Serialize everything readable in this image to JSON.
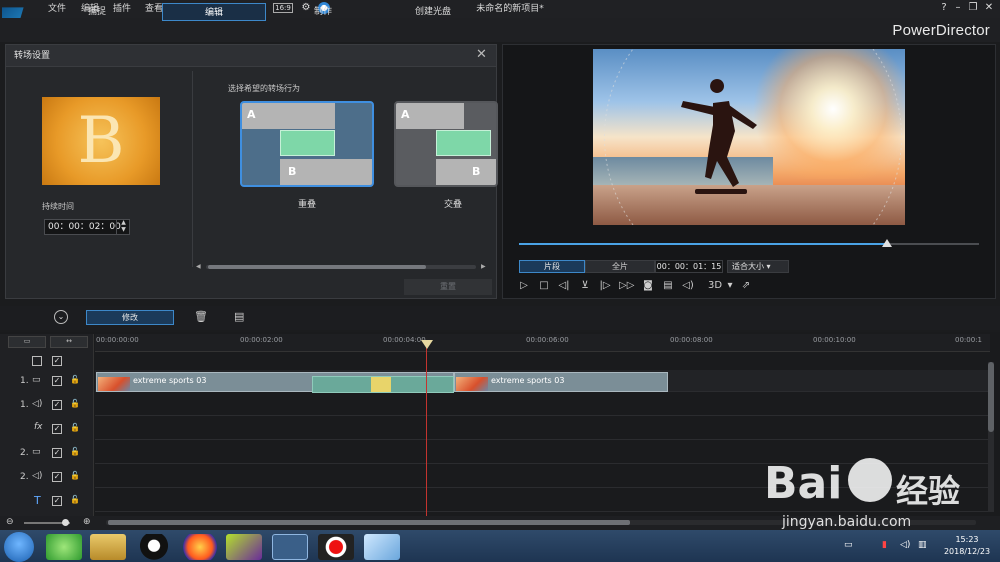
{
  "menu": [
    "文件",
    "编辑",
    "插件",
    "查看",
    "播放"
  ],
  "document_title": "未命名的新项目*",
  "brand": "PowerDirector",
  "tabs": [
    "捕捉",
    "编辑",
    "制作",
    "创建光盘"
  ],
  "transition_panel": {
    "title": "转场设置",
    "thumb_letter": "B",
    "duration_label": "持续时间",
    "duration_value": "00：00：02：00",
    "behavior_prompt": "选择希望的转场行为",
    "options": [
      {
        "label": "重叠",
        "selected": true
      },
      {
        "label": "交叠",
        "selected": false
      }
    ],
    "reset_label": "重置"
  },
  "preview": {
    "segment_btn": "片段",
    "full_btn": "全片",
    "timecode": "00：00：01：15",
    "fit_select": "适合大小",
    "mode_3d": "3D",
    "scrub_position": 0.8
  },
  "toolbar": {
    "modify_label": "修改"
  },
  "timeline": {
    "ticks": [
      "00:00:00:00",
      "00:00:02:00",
      "00:00:04:00",
      "00:00:06:00",
      "00:00:08:00",
      "00:00:10:00",
      "00:00:1"
    ],
    "track_labels": [
      "1.",
      "1.",
      "2.",
      "2."
    ],
    "clips": [
      {
        "name": "extreme sports 03"
      },
      {
        "name": "extreme sports 03"
      }
    ],
    "fx_label": "fx",
    "title_icon": "T"
  },
  "taskbar": {
    "time": "15:23",
    "date": "2018/12/23"
  },
  "watermark": {
    "brand": "Bai",
    "suffix": "经验",
    "url": "jingyan.baidu.com"
  }
}
